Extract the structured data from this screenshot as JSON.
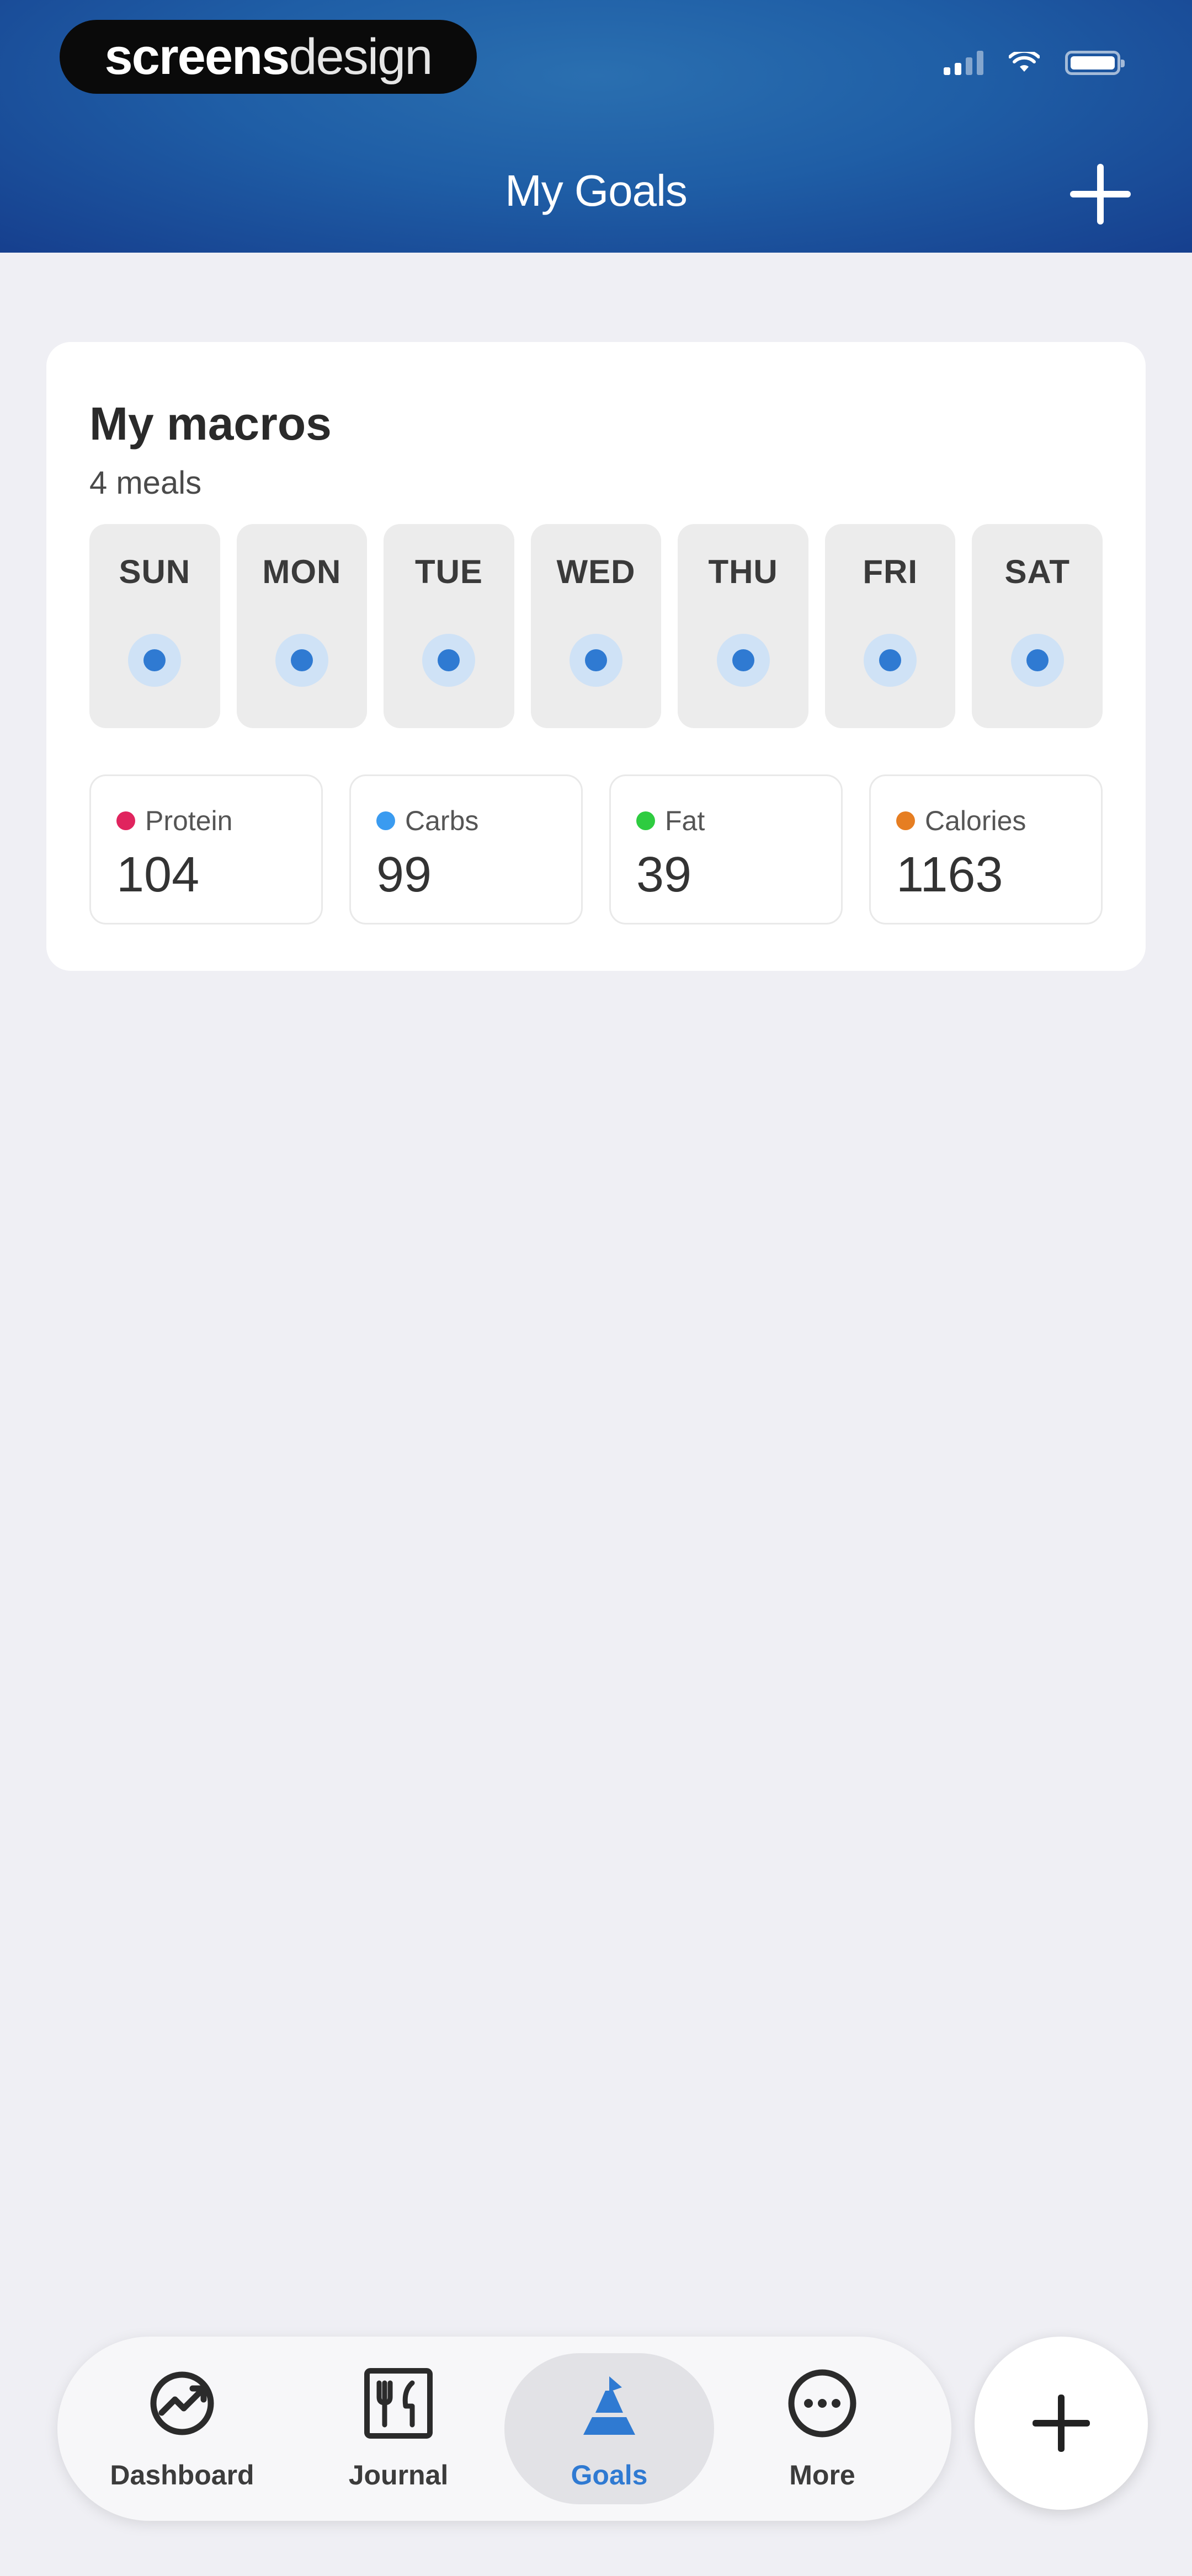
{
  "watermark": {
    "brand_bold": "screens",
    "brand_light": "design"
  },
  "header": {
    "title": "My Goals",
    "add_icon": "plus-icon"
  },
  "macros_card": {
    "title": "My macros",
    "subtitle": "4 meals",
    "days": [
      {
        "label": "SUN"
      },
      {
        "label": "MON"
      },
      {
        "label": "TUE"
      },
      {
        "label": "WED"
      },
      {
        "label": "THU"
      },
      {
        "label": "FRI"
      },
      {
        "label": "SAT"
      }
    ],
    "macros": [
      {
        "label": "Protein",
        "value": "104",
        "color": "#e0245e"
      },
      {
        "label": "Carbs",
        "value": "99",
        "color": "#3a9bf0"
      },
      {
        "label": "Fat",
        "value": "39",
        "color": "#2ecc40"
      },
      {
        "label": "Calories",
        "value": "1163",
        "color": "#e67e22"
      }
    ]
  },
  "tabbar": {
    "tabs": [
      {
        "label": "Dashboard",
        "icon": "gauge-icon",
        "active": false
      },
      {
        "label": "Journal",
        "icon": "journal-icon",
        "active": false
      },
      {
        "label": "Goals",
        "icon": "goals-icon",
        "active": true
      },
      {
        "label": "More",
        "icon": "more-icon",
        "active": false
      }
    ]
  },
  "fab": {
    "icon": "plus-icon"
  },
  "colors": {
    "accent": "#2f7ad2",
    "header": "#1f5ea6"
  }
}
